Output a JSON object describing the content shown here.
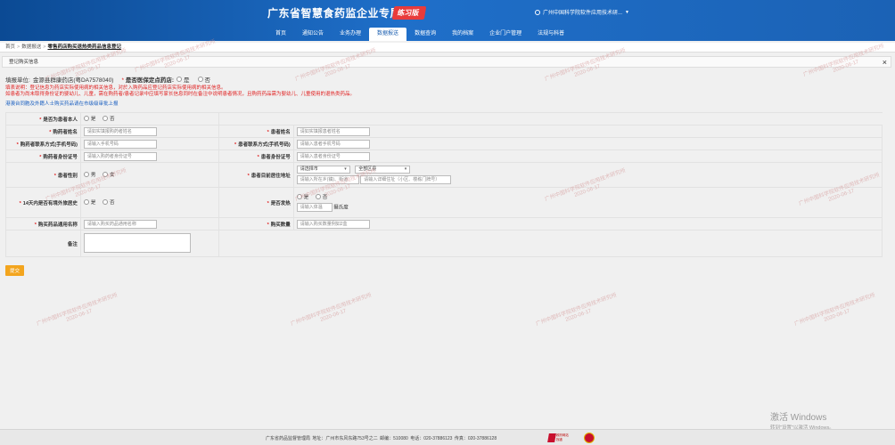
{
  "header": {
    "title": "广东省智慧食药监企业专属网页",
    "badge": "练习版",
    "user": "广州中国科学院软件应用技术研...",
    "nav": [
      "首页",
      "通知公告",
      "业务办理",
      "数据报送",
      "数据查询",
      "我的档案",
      "企业门户管理",
      "法规与科普"
    ],
    "active_nav": "数据报送"
  },
  "breadcrumb": {
    "items": [
      "首页",
      "数据报送"
    ],
    "current": "零售药店购买退热类药品信息登记"
  },
  "panel": {
    "title": "登记购买信息",
    "close": "×"
  },
  "info": {
    "unit_label": "填报单位:",
    "unit_value": "金源县群康药店(粤DA7578040)",
    "chain_question": "是否医保定点药店:",
    "yes": "是",
    "no": "否",
    "notice1": "填表说明：登记信息为药店实际使用病的相关信息，对於入购药品应登记药店实际使用病的相关信息。",
    "notice2": "如患者为尚未取得身份证的婴幼儿、儿童，需在购药者/患者记录中应填写家长信息同时在备注中说明患者情况，且购药药品需为婴幼儿、儿童使用的退热类药品。",
    "link": "港澳台同胞及外籍人士购买药品请在市级级审批上报"
  },
  "form": {
    "is_self_label": "是否为患者本人",
    "buyer_name_label": "购药者姓名",
    "buyer_name_ph": "请如实填报购药者姓名",
    "patient_name_label": "患者姓名",
    "patient_name_ph": "请如实填报患者姓名",
    "buyer_phone_label": "购药者联系方式(手机号码)",
    "buyer_phone_ph": "请输入手机号码",
    "patient_phone_label": "患者联系方式(手机号码)",
    "patient_phone_ph": "请输入患者手机号码",
    "buyer_id_label": "购药者身份证号",
    "buyer_id_ph": "请输入购药者身份证号",
    "patient_id_label": "患者身份证号",
    "patient_id_ph": "请输入患者身份证号",
    "gender_label": "患者性别",
    "male": "男",
    "female": "女",
    "address_label": "患者目前居住地址",
    "city_select": "请选择市",
    "district_select": "全部区县",
    "town_ph": "请输入所在乡(镇)、街道",
    "detail_ph": "请输入详细住址（小区、楼栋门牌号）",
    "travel_label": "14天内是否有境外旅居史",
    "fever_label": "是否发热",
    "temp_ph": "请输入体温",
    "temp_unit": "摄氏度",
    "drug_label": "购买药品通用名称",
    "drug_ph": "请输入购买药品通用名称",
    "qty_label": "购买数量",
    "qty_ph": "请输入购买数量例如2盒",
    "remark_label": "备注"
  },
  "submit": "提交",
  "footer": {
    "text": "广东省药品监督管理局   地址：广州市东风东路753号之二   邮编：510080   电话：020-37886123   传真：020-37886128",
    "logo_text": "政府网站 找错"
  },
  "windows": {
    "line1": "激活 Windows",
    "line2": "转到\"设置\"以激活 Windows。"
  },
  "watermark": {
    "line1": "广州中国科学院软件应用技术研究所",
    "line2": "2020-06-17"
  }
}
